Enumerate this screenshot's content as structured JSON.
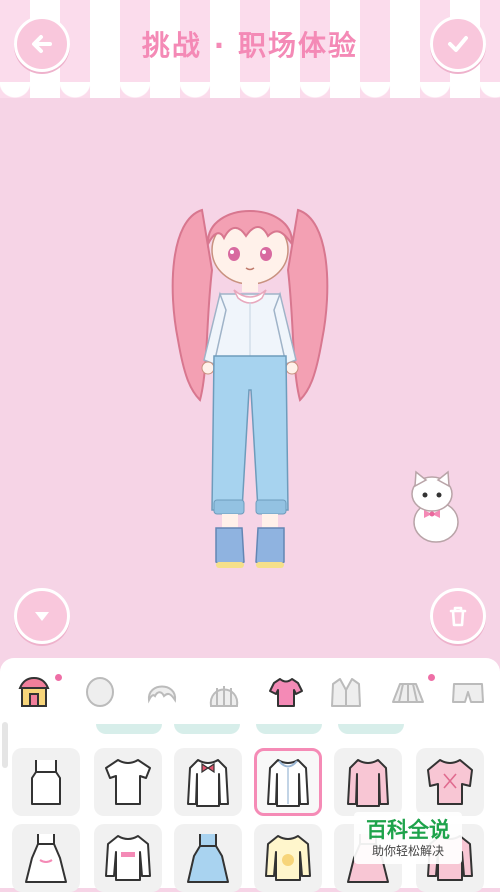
{
  "header": {
    "title": "挑战 · 职场体验",
    "back_icon": "back-arrow-icon",
    "confirm_icon": "checkmark-icon"
  },
  "controls": {
    "toggle_icon": "chevron-down-icon",
    "delete_icon": "trash-icon"
  },
  "category_tabs": [
    {
      "id": "shop",
      "icon": "shop-icon",
      "dot": true
    },
    {
      "id": "face",
      "icon": "face-icon",
      "dot": false
    },
    {
      "id": "hair-front",
      "icon": "bangs-icon",
      "dot": false
    },
    {
      "id": "hair-back",
      "icon": "hair-back-icon",
      "dot": false
    },
    {
      "id": "tops",
      "icon": "shirt-icon",
      "dot": false,
      "active": true
    },
    {
      "id": "coats",
      "icon": "jacket-icon",
      "dot": false
    },
    {
      "id": "skirts",
      "icon": "skirt-icon",
      "dot": true
    },
    {
      "id": "pants",
      "icon": "shorts-icon",
      "dot": false
    }
  ],
  "items_row1": [
    {
      "icon": "camisole-icon"
    },
    {
      "icon": "tshirt-icon"
    },
    {
      "icon": "bow-blouse-icon"
    },
    {
      "icon": "collar-blouse-icon",
      "selected": true
    },
    {
      "icon": "pink-top-icon"
    },
    {
      "icon": "lace-top-icon"
    }
  ],
  "items_row2": [
    {
      "icon": "dress-icon"
    },
    {
      "icon": "sweater-icon"
    },
    {
      "icon": "overalls-dress-icon"
    },
    {
      "icon": "yellow-top-icon"
    },
    {
      "icon": "pink-dress-icon"
    },
    {
      "icon": "pink-shirt-icon"
    }
  ],
  "watermark": {
    "title": "百科全说",
    "subtitle": "助你轻松解决"
  },
  "colors": {
    "background": "#f6d4e6",
    "accent": "#f48ab6",
    "button": "#f9c7dc",
    "panel": "#ffffff",
    "watermark_green": "#1ea34b"
  }
}
